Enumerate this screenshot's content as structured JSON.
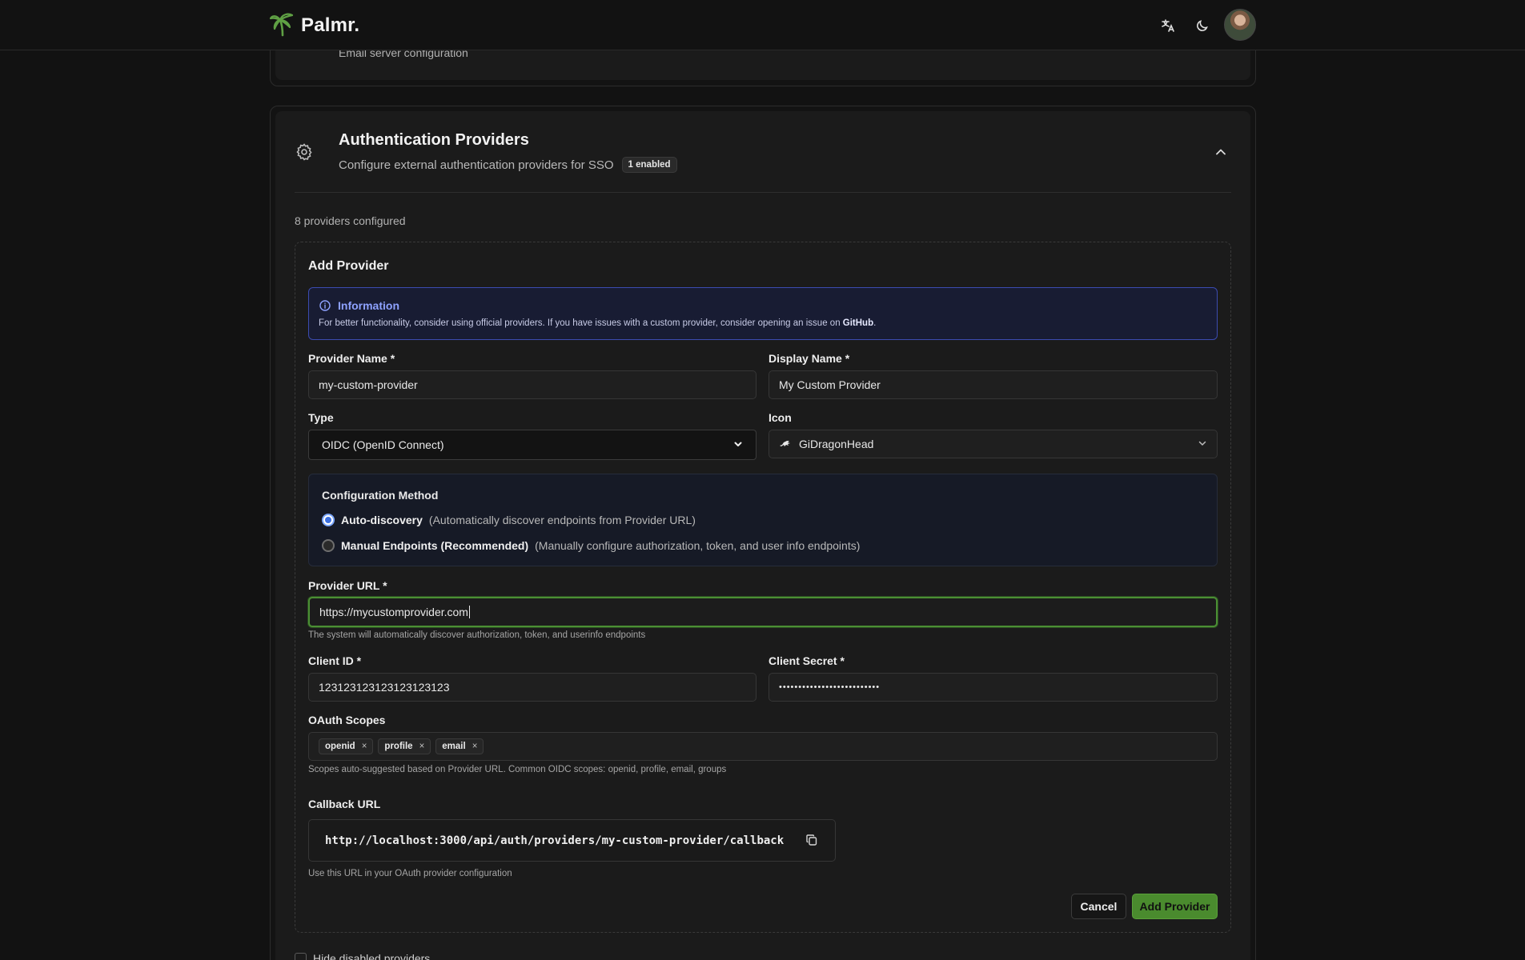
{
  "app": {
    "name": "Palmr."
  },
  "header": {
    "translate_icon": "translate-icon",
    "theme_icon": "moon-icon"
  },
  "email_section": {
    "subtitle": "Email server configuration"
  },
  "auth_section": {
    "title": "Authentication Providers",
    "subtitle": "Configure external authentication providers for SSO",
    "badge": "1 enabled",
    "providers_count": "8 providers configured"
  },
  "add_provider": {
    "title": "Add Provider",
    "info": {
      "title": "Information",
      "text_before": "For better functionality, consider using official providers. If you have issues with a custom provider, consider opening an issue on ",
      "link": "GitHub",
      "text_after": "."
    },
    "provider_name": {
      "label": "Provider Name *",
      "value": "my-custom-provider"
    },
    "display_name": {
      "label": "Display Name *",
      "value": "My Custom Provider"
    },
    "type": {
      "label": "Type",
      "value": "OIDC (OpenID Connect)"
    },
    "icon": {
      "label": "Icon",
      "value": "GiDragonHead"
    },
    "config_method": {
      "title": "Configuration Method",
      "options": [
        {
          "label": "Auto-discovery",
          "desc": "(Automatically discover endpoints from Provider URL)",
          "selected": true
        },
        {
          "label": "Manual Endpoints (Recommended)",
          "desc": "(Manually configure authorization, token, and user info endpoints)",
          "selected": false
        }
      ]
    },
    "provider_url": {
      "label": "Provider URL *",
      "value": "https://mycustomprovider.com",
      "help": "The system will automatically discover authorization, token, and userinfo endpoints"
    },
    "client_id": {
      "label": "Client ID *",
      "value": "123123123123123123123"
    },
    "client_secret": {
      "label": "Client Secret *",
      "value": "••••••••••••••••••••••••••"
    },
    "scopes": {
      "label": "OAuth Scopes",
      "items": [
        "openid",
        "profile",
        "email"
      ],
      "help": "Scopes auto-suggested based on Provider URL. Common OIDC scopes: openid, profile, email, groups"
    },
    "callback": {
      "label": "Callback URL",
      "url": "http://localhost:3000/api/auth/providers/my-custom-provider/callback",
      "help": "Use this URL in your OAuth provider configuration"
    },
    "cancel_label": "Cancel",
    "submit_label": "Add Provider"
  },
  "hide_disabled": {
    "label": "Hide disabled providers"
  },
  "colors": {
    "accent": "#4a8b2e",
    "info_border": "#3b4bb0",
    "focus_border": "#4b8f34"
  }
}
